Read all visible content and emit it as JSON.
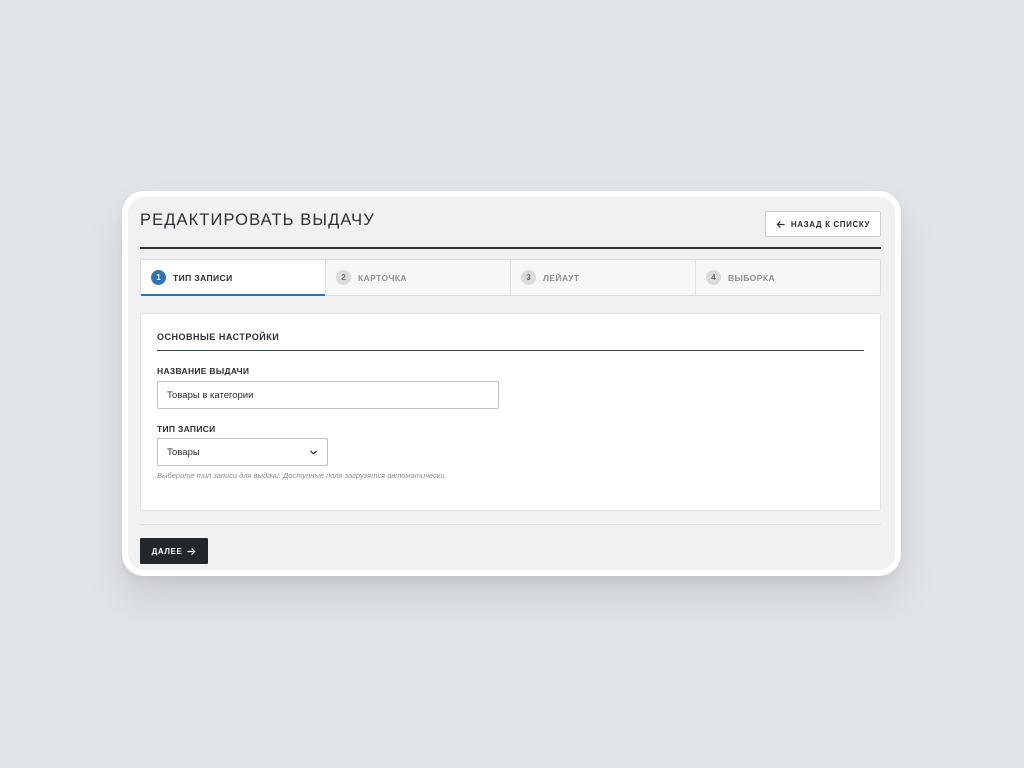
{
  "header": {
    "title": "РЕДАКТИРОВАТЬ ВЫДАЧУ",
    "back_button": "НАЗАД К СПИСКУ",
    "back_icon": "arrow-left-icon"
  },
  "steps": [
    {
      "number": "1",
      "label": "ТИП ЗАПИСИ",
      "active": true
    },
    {
      "number": "2",
      "label": "КАРТОЧКА",
      "active": false
    },
    {
      "number": "3",
      "label": "ЛЕЙАУТ",
      "active": false
    },
    {
      "number": "4",
      "label": "ВЫБОРКА",
      "active": false
    }
  ],
  "form": {
    "section_title": "ОСНОВНЫЕ НАСТРОЙКИ",
    "name_label": "НАЗВАНИЕ ВЫДАЧИ",
    "name_value": "Товары в категории",
    "type_label": "ТИП ЗАПИСИ",
    "type_value": "Товары",
    "type_icon": "chevron-down-icon",
    "type_help": "Выберите тип записи для выдачи. Доступные поля загрузятся автоматически."
  },
  "footer": {
    "next_button": "ДАЛЕЕ",
    "next_icon": "arrow-right-icon"
  },
  "colors": {
    "accent": "#2f74b5",
    "primary_button": "#22272b",
    "background": "#e2e5e8"
  }
}
